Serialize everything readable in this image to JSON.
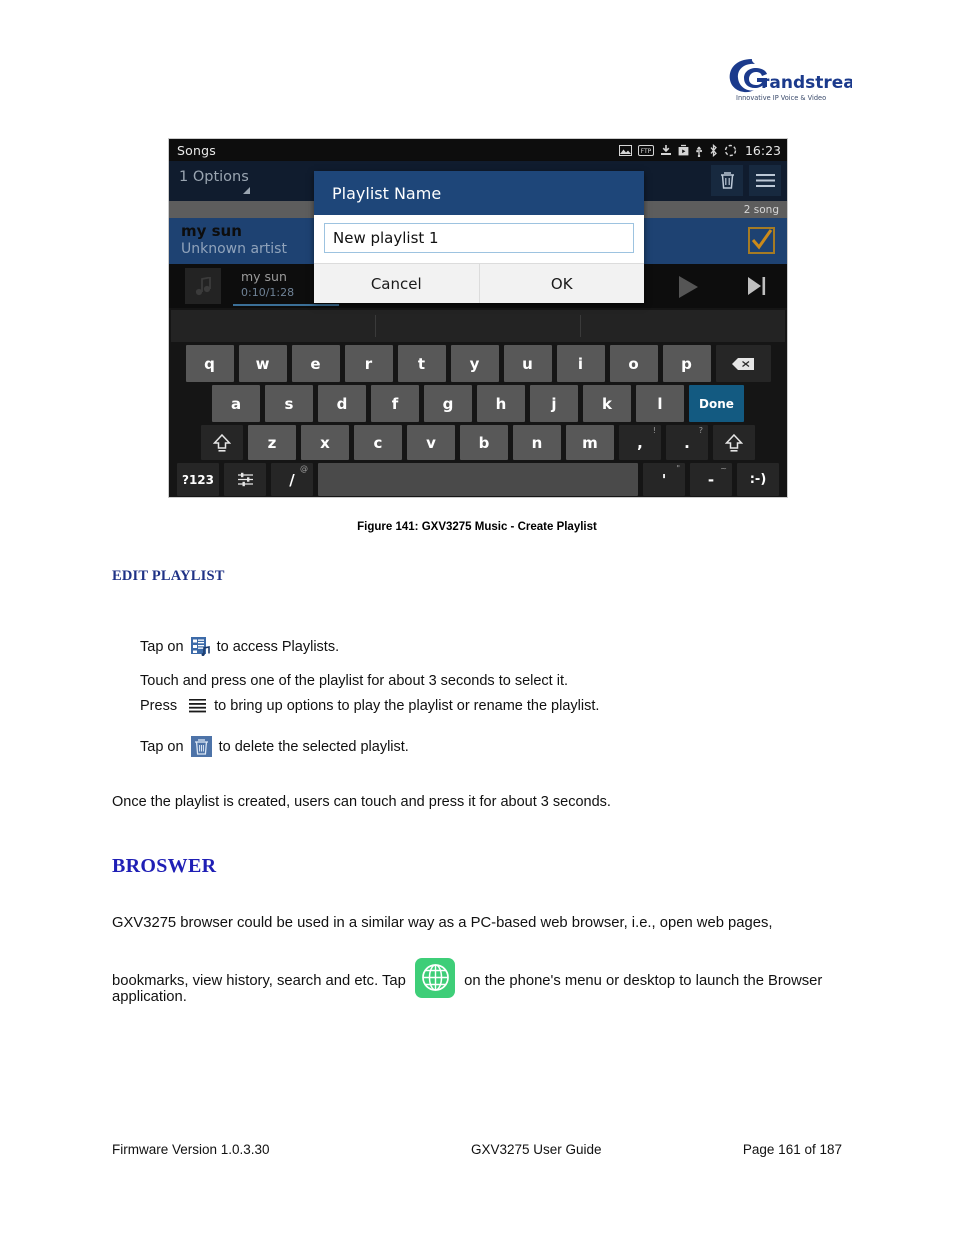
{
  "logo": {
    "brand": "randstream",
    "tagline": "Innovative IP Voice & Video"
  },
  "phone": {
    "statusbar": {
      "title": "Songs",
      "time": "16:23",
      "icons": [
        "image-icon",
        "ftp-icon",
        "download-icon",
        "app-install-icon",
        "usb-icon",
        "bluetooth-icon",
        "sync-icon"
      ]
    },
    "appbar": {
      "options_label": "1 Options",
      "delete_icon": "trash-icon",
      "menu_icon": "hamburger-menu-icon"
    },
    "subheader": {
      "count_label": "2 song"
    },
    "song": {
      "title": "my sun",
      "artist": "Unknown artist",
      "checked": true
    },
    "miniplayer": {
      "title": "my sun",
      "time": "0:10/1:28",
      "play_icon": "play-icon",
      "next_icon": "next-track-icon"
    },
    "dialog": {
      "header": "Playlist Name",
      "input_value": "New playlist 1",
      "cancel_label": "Cancel",
      "ok_label": "OK"
    },
    "keyboard": {
      "row1": [
        "q",
        "w",
        "e",
        "r",
        "t",
        "y",
        "u",
        "i",
        "o",
        "p"
      ],
      "backspace_icon": "backspace-icon",
      "row2": [
        "a",
        "s",
        "d",
        "f",
        "g",
        "h",
        "j",
        "k",
        "l"
      ],
      "done_label": "Done",
      "row3": [
        "z",
        "x",
        "c",
        "v",
        "b",
        "n",
        "m"
      ],
      "comma_key": ",",
      "comma_sup": "!",
      "period_key": ".",
      "period_sup": "?",
      "shift_icon": "shift-icon",
      "symbols_label": "?123",
      "settings_icon": "keyboard-settings-icon",
      "slash_key": "/",
      "slash_sup": "@",
      "apostrophe_key": "'",
      "apostrophe_sup": "\"",
      "dash_key": "-",
      "dash_sup": "~",
      "emoji_key": ":-)"
    }
  },
  "document": {
    "figure_caption": "Figure 141: GXV3275 Music - Create Playlist",
    "edit_playlist_heading": "EDIT PLAYLIST",
    "steps": {
      "step1_pre": "Tap on",
      "step1_post": "to access Playlists.",
      "step2": "Touch and press one of the playlist for about 3 seconds to select it.",
      "step3_pre": "Press",
      "step3_post": "to bring up options to play the playlist or rename the playlist.",
      "step4_pre": "Tap on",
      "step4_post": "to delete the selected playlist."
    },
    "note": "Once the playlist is created, users can touch and press it for about 3 seconds.",
    "browser_heading": "BROSWER",
    "browser_para_1": "GXV3275 browser could be used in a similar way as a PC-based web browser, i.e., open web pages,",
    "browser_para_2a": "bookmarks, view history, search and etc. Tap",
    "browser_para_2b": "on the phone's menu or desktop to launch the Browser",
    "browser_para_3": "application.",
    "icons": {
      "playlist_icon": "playlist-icon",
      "menu_icon": "hamburger-menu-icon",
      "delete_icon": "trash-icon",
      "browser_icon": "globe-browser-icon"
    }
  },
  "footer": {
    "firmware": "Firmware Version 1.0.3.30",
    "guide": "GXV3275 User Guide",
    "page": "Page 161 of 187"
  },
  "colors": {
    "heading_blue": "#1f1fb5",
    "subheading_blue": "#1f3286",
    "browser_green": "#3ece78",
    "dialog_blue": "#1e4679",
    "checkbox_orange": "#cc8a1a"
  }
}
